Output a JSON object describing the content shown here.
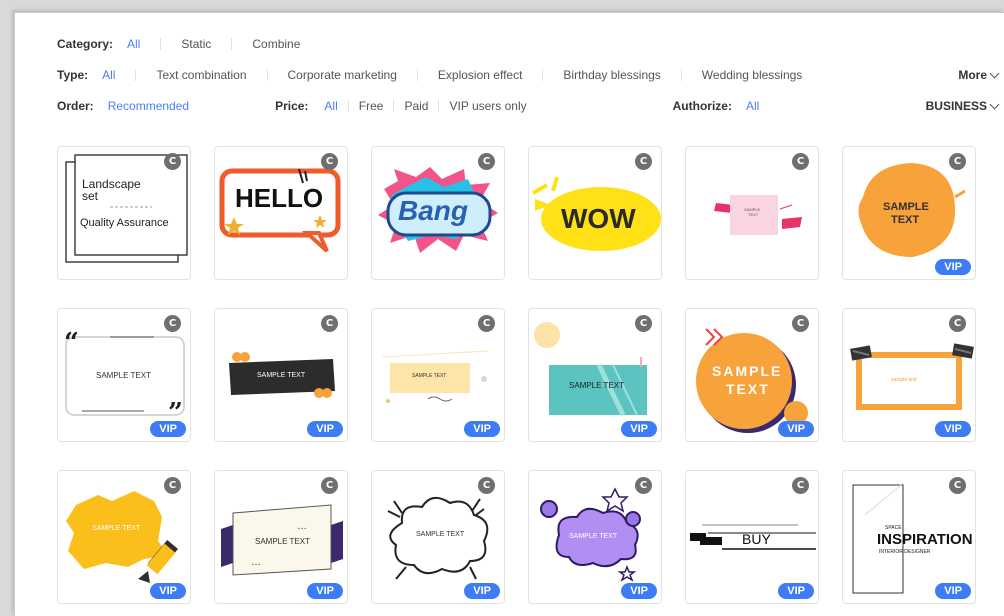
{
  "filters": {
    "category": {
      "label": "Category:",
      "options": [
        "All",
        "Static",
        "Combine"
      ]
    },
    "type": {
      "label": "Type:",
      "options": [
        "All",
        "Text combination",
        "Corporate marketing",
        "Explosion effect",
        "Birthday blessings",
        "Wedding blessings"
      ],
      "more": "More"
    },
    "order": {
      "label": "Order:",
      "value": "Recommended"
    },
    "price": {
      "label": "Price:",
      "options": [
        "All",
        "Free",
        "Paid",
        "VIP users only"
      ]
    },
    "authorize": {
      "label": "Authorize:",
      "value": "All"
    },
    "business": "BUSINESS"
  },
  "badges": {
    "c": "C",
    "vip": "VIP"
  },
  "cards": [
    {
      "id": "landscape-set",
      "texts": [
        "Landscape",
        "set",
        "Quality Assurance"
      ],
      "vip": false
    },
    {
      "id": "hello",
      "texts": [
        "HELLO"
      ],
      "vip": false
    },
    {
      "id": "bang",
      "texts": [
        "Bang"
      ],
      "vip": false
    },
    {
      "id": "wow",
      "texts": [
        "WOW"
      ],
      "vip": false
    },
    {
      "id": "pink-sample",
      "texts": [
        "SAMPLE",
        "TEXT"
      ],
      "vip": false
    },
    {
      "id": "orange-brush",
      "texts": [
        "SAMPLE",
        "TEXT"
      ],
      "vip": true
    },
    {
      "id": "quote-frame",
      "texts": [
        "SAMPLE TEXT"
      ],
      "vip": true
    },
    {
      "id": "dark-banner",
      "texts": [
        "SAMPLE TEXT"
      ],
      "vip": true
    },
    {
      "id": "yellow-label",
      "texts": [
        "SAMPLE TEXT"
      ],
      "vip": true
    },
    {
      "id": "teal-box",
      "texts": [
        "SAMPLE TEXT"
      ],
      "vip": true
    },
    {
      "id": "orange-circle",
      "texts": [
        "SAMPLE",
        "TEXT"
      ],
      "vip": true
    },
    {
      "id": "tape-frame",
      "texts": [
        "sample text"
      ],
      "vip": true
    },
    {
      "id": "yellow-splash",
      "texts": [
        "SAMPLE TEXT"
      ],
      "vip": true
    },
    {
      "id": "paper-banner",
      "texts": [
        "SAMPLE TEXT"
      ],
      "vip": true
    },
    {
      "id": "comic-cloud",
      "texts": [
        "SAMPLE TEXT"
      ],
      "vip": true
    },
    {
      "id": "purple-cloud",
      "texts": [
        "SAMPLE TEXT"
      ],
      "vip": true
    },
    {
      "id": "buy-line",
      "texts": [
        "BUY"
      ],
      "vip": true
    },
    {
      "id": "inspiration",
      "texts": [
        "SPACE",
        "INSPIRATION",
        "INTERIOR DESIGNER"
      ],
      "vip": true
    }
  ],
  "colors": {
    "accent": "#4a7ef7",
    "vip": "#3e7cf5",
    "c_badge": "#6f6f6f"
  }
}
